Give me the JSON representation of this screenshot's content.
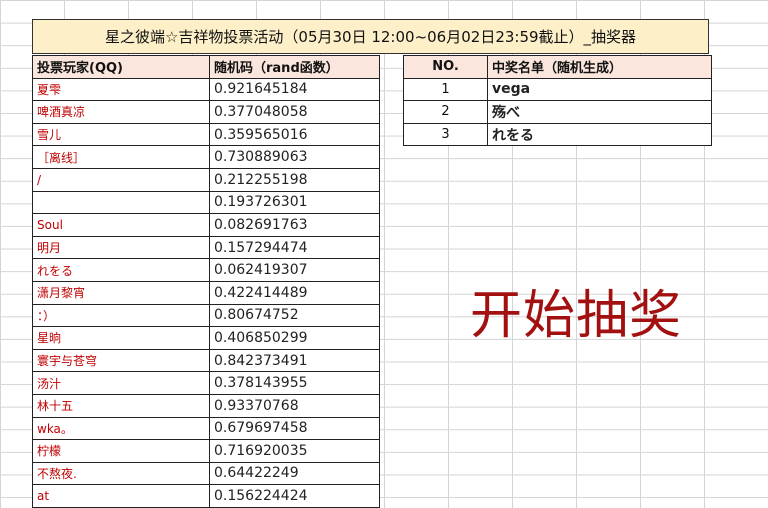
{
  "title": "星之彼端☆吉祥物投票活动（05月30日 12:00~06月02日23:59截止）_抽奖器",
  "players_table": {
    "headers": [
      "投票玩家(QQ)",
      "随机码（rand函数）"
    ],
    "rows": [
      {
        "name": "夏雫",
        "rand": "0.921645184"
      },
      {
        "name": "啤酒真凉",
        "rand": "0.377048058"
      },
      {
        "name": "雪儿",
        "rand": "0.359565016"
      },
      {
        "name": "［离线］",
        "rand": "0.730889063"
      },
      {
        "name": "/",
        "rand": "0.212255198"
      },
      {
        "name": "",
        "rand": "0.193726301"
      },
      {
        "name": "Soul",
        "rand": "0.082691763"
      },
      {
        "name": "明月",
        "rand": "0.157294474"
      },
      {
        "name": "れをる",
        "rand": "0.062419307"
      },
      {
        "name": "潇月黎宵",
        "rand": "0.422414489"
      },
      {
        "name": "：）",
        "rand": "0.80674752"
      },
      {
        "name": "星晌",
        "rand": "0.406850299"
      },
      {
        "name": "寰宇与苍穹",
        "rand": "0.842373491"
      },
      {
        "name": "汤汁",
        "rand": "0.378143955"
      },
      {
        "name": "林十五",
        "rand": "0.93370768"
      },
      {
        "name": "wka。",
        "rand": "0.679697458"
      },
      {
        "name": "柠檬",
        "rand": "0.716920035"
      },
      {
        "name": "不熬夜.",
        "rand": "0.64422249"
      },
      {
        "name": "at",
        "rand": "0.156224424"
      }
    ]
  },
  "winners_table": {
    "headers": [
      "NO.",
      "中奖名单（随机生成）"
    ],
    "rows": [
      {
        "no": "1",
        "name": "vega"
      },
      {
        "no": "2",
        "name": "殇べ"
      },
      {
        "no": "3",
        "name": "れをる"
      }
    ]
  },
  "draw_button": {
    "label": "开始抽奖",
    "color": "#a31010"
  },
  "colors": {
    "title_bg": "#fdf0c8",
    "header_bg": "#fbe6dd",
    "player_name": "#c00000"
  }
}
